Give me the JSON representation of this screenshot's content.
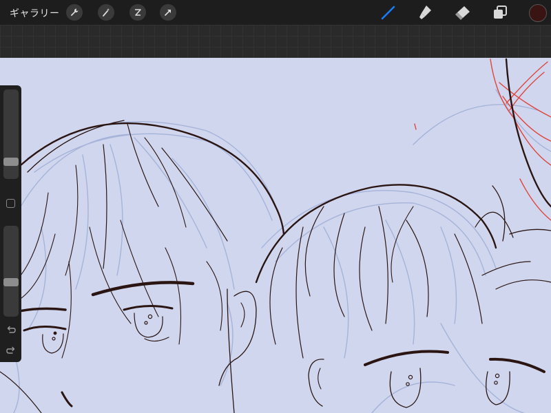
{
  "toolbar": {
    "gallery_label": "ギャラリー",
    "left_tools": [
      "wrench-icon",
      "magic-wand-icon",
      "selection-icon",
      "transform-arrow-icon"
    ],
    "right_tools": [
      "brush-icon",
      "smudge-icon",
      "eraser-icon",
      "layers-icon"
    ],
    "active_tool": "brush-icon",
    "accent_color": "#1a7cf5",
    "current_color": "#3a1412"
  },
  "sidebar": {
    "brush_size_level": 0.28,
    "opacity_level": 0.63,
    "controls": [
      "size-slider",
      "modifier-button",
      "opacity-slider",
      "undo-icon",
      "redo-icon"
    ]
  },
  "canvas": {
    "background_color": "#cfd6ee",
    "line_color": "#2a1512",
    "sketch_color": "#a6b3d9",
    "guide_color": "#e0443c"
  }
}
